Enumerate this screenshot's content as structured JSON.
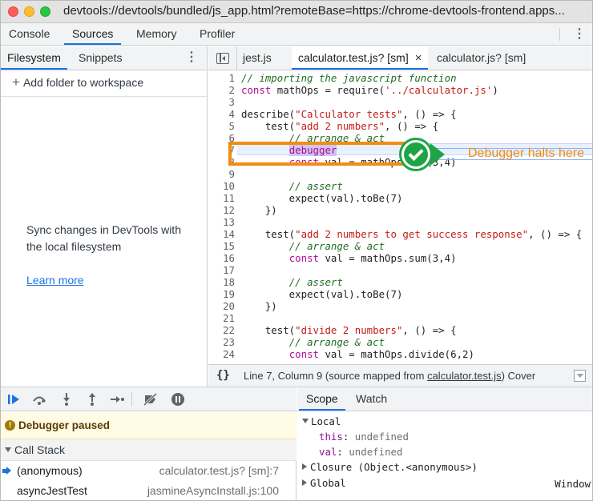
{
  "window": {
    "url": "devtools://devtools/bundled/js_app.html?remoteBase=https://chrome-devtools-frontend.apps..."
  },
  "main_tabs": [
    "Console",
    "Sources",
    "Memory",
    "Profiler"
  ],
  "active_main_tab": "Sources",
  "navigator": {
    "tabs": [
      "Filesystem",
      "Snippets"
    ],
    "add_folder": "Add folder to workspace",
    "sync_text": "Sync changes in DevTools with the local filesystem",
    "learn_more": "Learn more"
  },
  "editor": {
    "tabs": [
      {
        "label": "jest.js"
      },
      {
        "label": "calculator.test.js? [sm]",
        "close": "×"
      },
      {
        "label": "calculator.js? [sm]"
      }
    ],
    "status": {
      "braces": "{}",
      "position": "Line 7, Column 9",
      "source_prefix": "(source mapped from ",
      "source_link": "calculator.test.js",
      "source_suffix": ")",
      "coverage": "Cover"
    }
  },
  "code_lines": [
    {
      "n": "1",
      "text": "// importing the javascript function"
    },
    {
      "n": "2",
      "text": "const mathOps = require('../calculator.js')"
    },
    {
      "n": "3",
      "text": ""
    },
    {
      "n": "4",
      "text": "describe(\"Calculator tests\", () => {"
    },
    {
      "n": "5",
      "text": "    test(\"add 2 numbers\", () => {"
    },
    {
      "n": "6",
      "text": "        // arrange & act"
    },
    {
      "n": "7",
      "text": "        debugger"
    },
    {
      "n": "8",
      "text": "        const val = mathOps.sum(3,4)"
    },
    {
      "n": "9",
      "text": ""
    },
    {
      "n": "10",
      "text": "        // assert"
    },
    {
      "n": "11",
      "text": "        expect(val).toBe(7)"
    },
    {
      "n": "12",
      "text": "    })"
    },
    {
      "n": "13",
      "text": ""
    },
    {
      "n": "14",
      "text": "    test(\"add 2 numbers to get success response\", () => {"
    },
    {
      "n": "15",
      "text": "        // arrange & act"
    },
    {
      "n": "16",
      "text": "        const val = mathOps.sum(3,4)"
    },
    {
      "n": "17",
      "text": ""
    },
    {
      "n": "18",
      "text": "        // assert"
    },
    {
      "n": "19",
      "text": "        expect(val).toBe(7)"
    },
    {
      "n": "20",
      "text": "    })"
    },
    {
      "n": "21",
      "text": ""
    },
    {
      "n": "22",
      "text": "    test(\"divide 2 numbers\", () => {"
    },
    {
      "n": "23",
      "text": "        // arrange & act"
    },
    {
      "n": "24",
      "text": "        const val = mathOps.divide(6,2)"
    }
  ],
  "annotation": {
    "label": "Debugger halts here",
    "color": "#f28c13"
  },
  "debugger": {
    "paused_text": "Debugger paused",
    "call_stack_title": "Call Stack",
    "frames": [
      {
        "name": "(anonymous)",
        "location": "calculator.test.js? [sm]:7",
        "current": true
      },
      {
        "name": "asyncJestTest",
        "location": "jasmineAsyncInstall.js:100",
        "current": false
      }
    ]
  },
  "scope": {
    "tabs": [
      "Scope",
      "Watch"
    ],
    "local_label": "Local",
    "vars": [
      {
        "name": "this",
        "value": "undefined"
      },
      {
        "name": "val",
        "value": "undefined"
      }
    ],
    "closure_label": "Closure (Object.<anonymous>)",
    "global_label": "Global",
    "global_value": "Window"
  }
}
